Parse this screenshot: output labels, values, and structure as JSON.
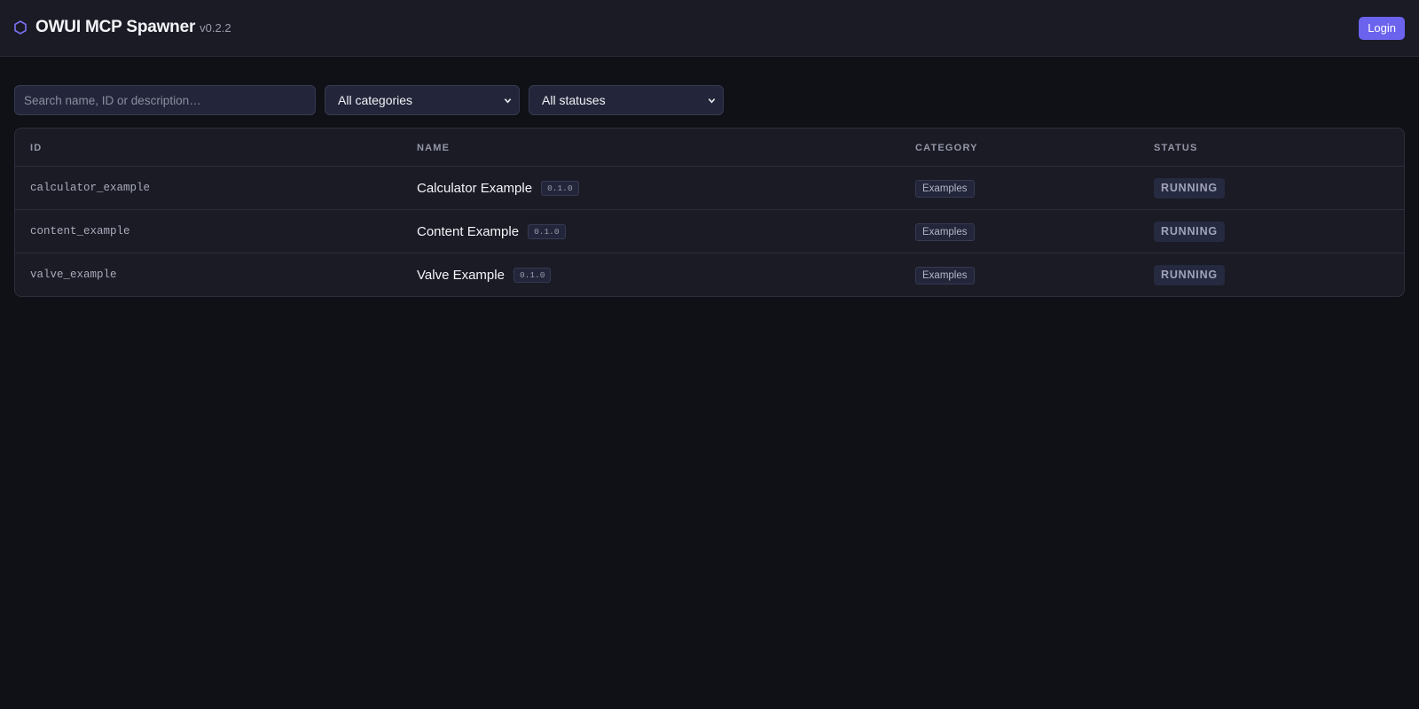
{
  "header": {
    "title": "OWUI MCP Spawner",
    "version": "v0.2.2",
    "login_label": "Login",
    "icon": "hexagon-icon"
  },
  "filters": {
    "search_placeholder": "Search name, ID or description…",
    "search_value": "",
    "category_selected": "All categories",
    "status_selected": "All statuses"
  },
  "table": {
    "columns": [
      "ID",
      "NAME",
      "CATEGORY",
      "STATUS"
    ],
    "rows": [
      {
        "id": "calculator_example",
        "name": "Calculator Example",
        "version": "0.1.0",
        "category": "Examples",
        "status": "RUNNING"
      },
      {
        "id": "content_example",
        "name": "Content Example",
        "version": "0.1.0",
        "category": "Examples",
        "status": "RUNNING"
      },
      {
        "id": "valve_example",
        "name": "Valve Example",
        "version": "0.1.0",
        "category": "Examples",
        "status": "RUNNING"
      }
    ]
  },
  "colors": {
    "accent": "#6b63ee",
    "background": "#101116",
    "panel": "#1a1b25"
  }
}
